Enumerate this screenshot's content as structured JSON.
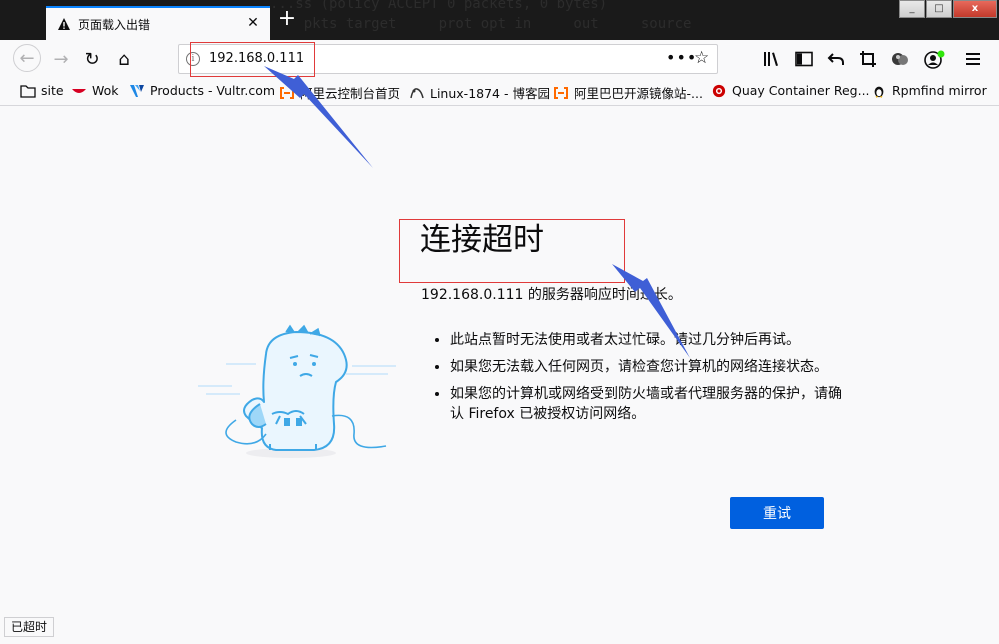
{
  "terminal_bg": "...ss (policy ACCEPT 0 packets, 0 bytes)\n    pkts target     prot opt in     out     source",
  "window": {
    "min": "_",
    "max": "□",
    "close": "x"
  },
  "tab": {
    "title": "页面载入出错",
    "close": "✕"
  },
  "newtab": "+",
  "nav": {
    "back": "←",
    "forward": "→",
    "reload": "↻",
    "home": "⌂"
  },
  "urlbar": {
    "info": "i",
    "url": "192.168.0.111",
    "more": "•••",
    "star": "☆"
  },
  "toolbar_icons": [
    "library-icon",
    "sidebar-icon",
    "undo-icon",
    "crop-icon",
    "extension-icon",
    "account-icon",
    "menu-icon"
  ],
  "bookmarks": [
    {
      "label": "site",
      "icon": "folder-icon"
    },
    {
      "label": "Wok",
      "icon": "wok-icon"
    },
    {
      "label": "Products - Vultr.com",
      "icon": "vultr-icon"
    },
    {
      "label": "阿里云控制台首页",
      "icon": "aliyun-icon"
    },
    {
      "label": "Linux-1874 - 博客园",
      "icon": "cnblogs-icon"
    },
    {
      "label": "阿里巴巴开源镜像站-...",
      "icon": "aliyun-mirror-icon"
    },
    {
      "label": "Quay Container Reg...",
      "icon": "quay-icon"
    },
    {
      "label": "Rpmfind mirror",
      "icon": "tux-icon"
    }
  ],
  "error": {
    "title": "连接超时",
    "description": "192.168.0.111 的服务器响应时间过长。",
    "items": [
      "此站点暂时无法使用或者太过忙碌。请过几分钟后再试。",
      "如果您无法载入任何网页，请检查您计算机的网络连接状态。",
      "如果您的计算机或网络受到防火墙或者代理服务器的保护，请确认 Firefox 已被授权访问网络。"
    ],
    "retry": "重试"
  },
  "statusbar": "已超时",
  "colors": {
    "accent": "#0a84ff",
    "button": "#0060df",
    "annotation_box": "#e03a3a",
    "annotation_arrow": "#3f5fd6"
  }
}
